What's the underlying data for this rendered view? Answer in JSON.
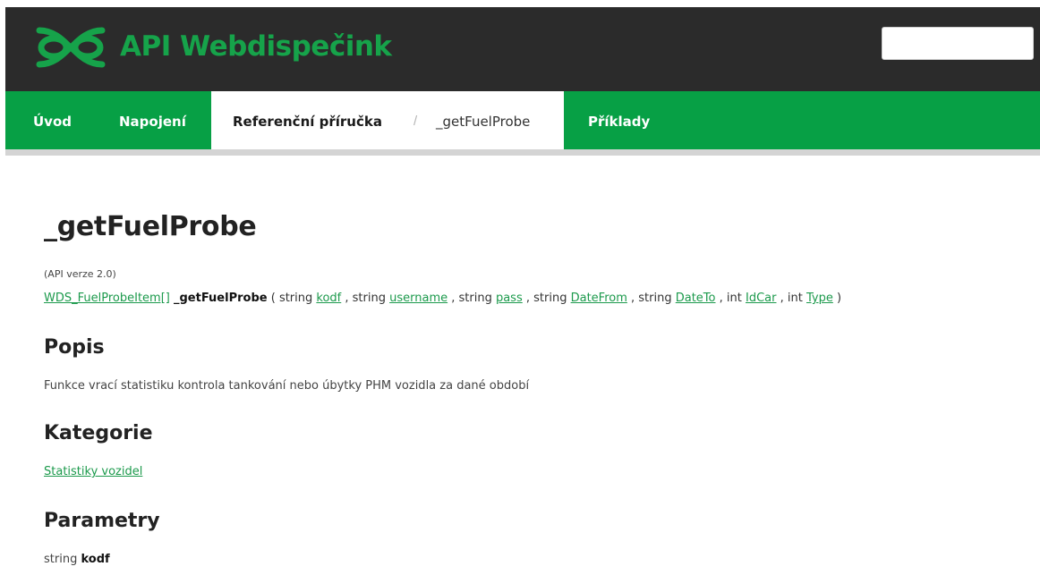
{
  "header": {
    "brand": "API Webdispečink",
    "logo_icon": "webdispecink-logo-icon",
    "search": {
      "value": "",
      "placeholder": ""
    }
  },
  "nav": {
    "items": [
      {
        "label": "Úvod"
      },
      {
        "label": "Napojení"
      },
      {
        "label": "Referenční příručka"
      },
      {
        "label": "Příklady"
      }
    ],
    "breadcrumb_separator": "/",
    "breadcrumb_current": "_getFuelProbe"
  },
  "page": {
    "title": "_getFuelProbe",
    "version": "(API verze 2.0)",
    "signature": {
      "return_type": "WDS_FuelProbeItem[]",
      "function_name": "_getFuelProbe",
      "open_paren": "( ",
      "close_paren": " )",
      "params": [
        {
          "type": "string",
          "name": "kodf"
        },
        {
          "type": "string",
          "name": "username"
        },
        {
          "type": "string",
          "name": "pass"
        },
        {
          "type": "string",
          "name": "DateFrom"
        },
        {
          "type": "string",
          "name": "DateTo"
        },
        {
          "type": "int",
          "name": "IdCar"
        },
        {
          "type": "int",
          "name": "Type"
        }
      ]
    },
    "description_heading": "Popis",
    "description": "Funkce vrací statistiku kontrola tankování nebo úbytky PHM vozidla za dané období",
    "category_heading": "Kategorie",
    "category_link": "Statistiky vozidel",
    "parameters_heading": "Parametry",
    "first_parameter": {
      "type": "string",
      "name": "kodf"
    }
  },
  "colors": {
    "header_bg": "#2b2b2b",
    "brand_green": "#16a34a",
    "nav_bg": "#07a045",
    "link": "#1c9a4c"
  }
}
